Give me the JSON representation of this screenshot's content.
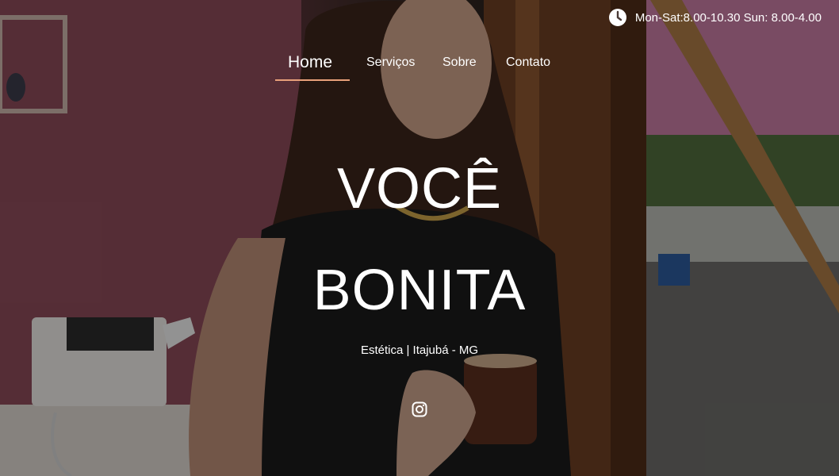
{
  "topbar": {
    "hours": "Mon-Sat:8.00-10.30 Sun: 8.00-4.00",
    "icon": "clock-icon"
  },
  "nav": {
    "items": [
      "Home",
      "Serviços",
      "Sobre",
      "Contato"
    ],
    "active": "Home",
    "accent": "#e8a07a"
  },
  "hero": {
    "title_line1": "VOCÊ",
    "title_line2": "BONITA",
    "subtitle": "Estética | Itajubá - MG"
  },
  "social": {
    "icon": "instagram-icon"
  }
}
